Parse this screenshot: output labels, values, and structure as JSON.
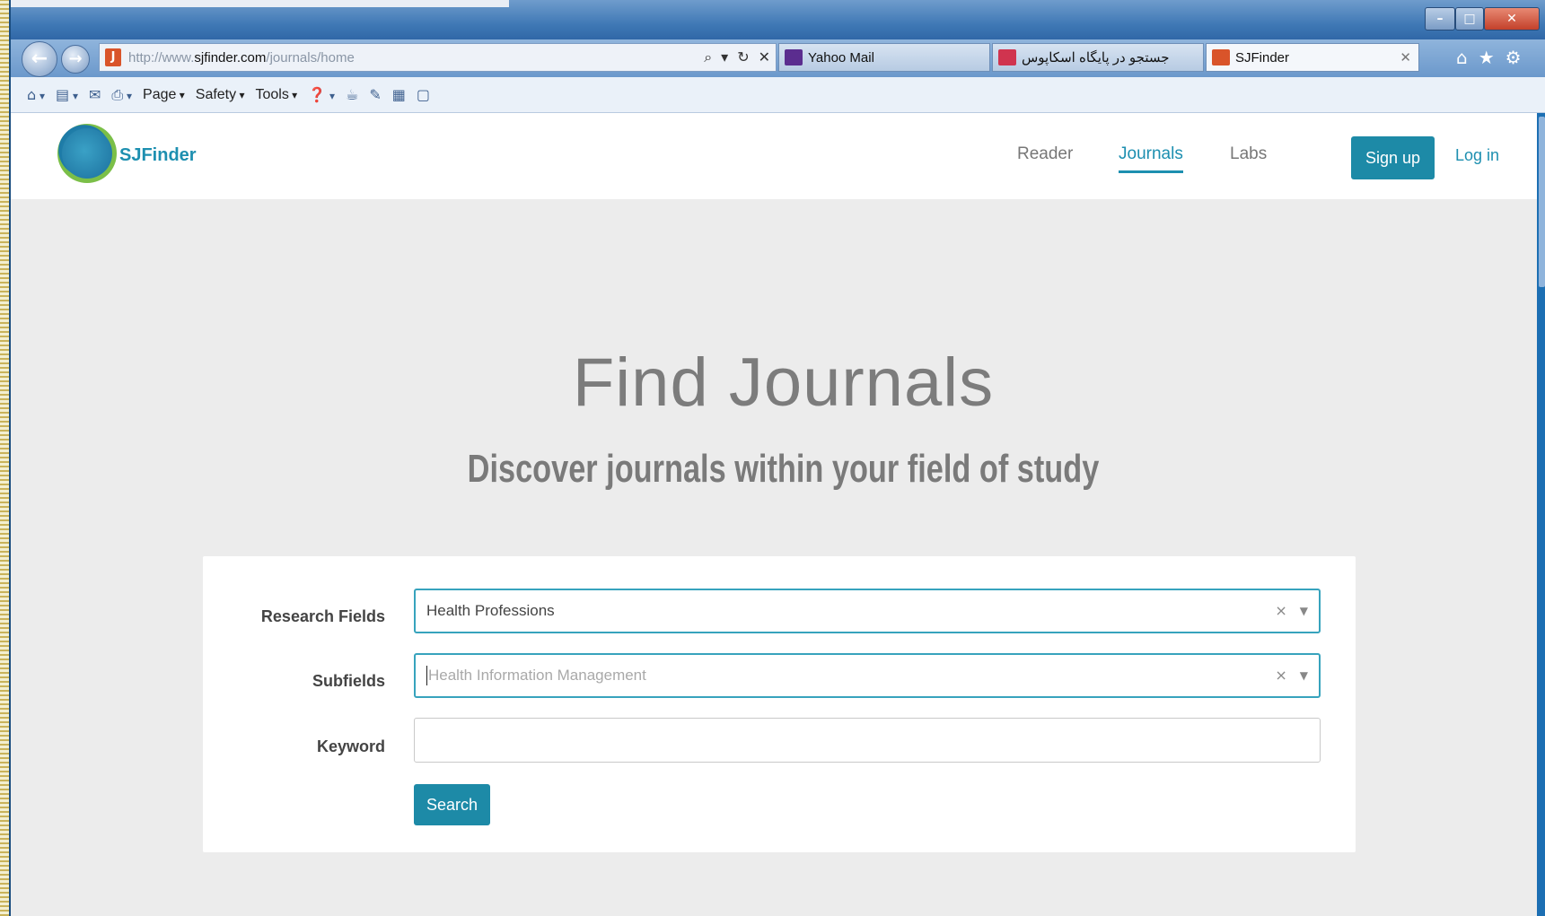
{
  "browser": {
    "address": {
      "prefix": "http://www.",
      "domain": "sjfinder.com",
      "path": "/journals/home"
    },
    "tabs": [
      {
        "label": "Yahoo Mail",
        "color": "#5b2d8f"
      },
      {
        "label": "جستجو در پایگاه اسکاپوس",
        "color": "#d0344f"
      },
      {
        "label": "SJFinder",
        "color": "#d9542a"
      }
    ],
    "commandbar": {
      "page_label": "Page",
      "safety_label": "Safety",
      "tools_label": "Tools"
    },
    "icons": [
      "back-icon",
      "forward-icon",
      "search-icon",
      "refresh-icon",
      "stop-icon",
      "home-icon",
      "favorites-icon",
      "settings-icon"
    ]
  },
  "site": {
    "logo_text": "SJFinder",
    "nav": {
      "reader": "Reader",
      "journals": "Journals",
      "labs": "Labs"
    },
    "signup": "Sign up",
    "login": "Log in",
    "accent_color": "#1d8aa7"
  },
  "hero": {
    "title": "Find Journals",
    "subtitle": "Discover journals within your field of study"
  },
  "form": {
    "research_fields": {
      "label": "Research Fields",
      "value": "Health Professions"
    },
    "subfields": {
      "label": "Subfields",
      "placeholder": "Health Information Management"
    },
    "keyword": {
      "label": "Keyword",
      "value": ""
    },
    "search_button": "Search"
  }
}
